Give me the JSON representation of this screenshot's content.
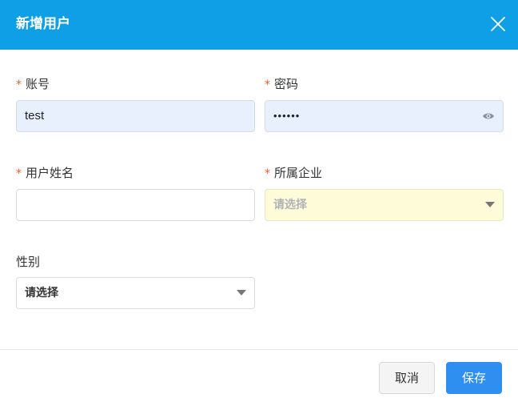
{
  "dialog": {
    "title": "新增用户",
    "close_icon": "close-icon"
  },
  "form": {
    "account": {
      "label": "账号",
      "required_mark": "*",
      "value": "test"
    },
    "password": {
      "label": "密码",
      "required_mark": "*",
      "value": "••••••",
      "toggle_icon": "eye-icon"
    },
    "user_name": {
      "label": "用户姓名",
      "required_mark": "*",
      "value": ""
    },
    "company": {
      "label": "所属企业",
      "required_mark": "*",
      "placeholder": "请选择"
    },
    "gender": {
      "label": "性别",
      "selected": "请选择"
    }
  },
  "footer": {
    "cancel_label": "取消",
    "save_label": "保存"
  },
  "colors": {
    "header": "#0f9fe6",
    "required": "#f05a28",
    "save_button": "#2e8ff0",
    "filled_input": "#e8f0fe",
    "warn_input": "#fefbd8"
  }
}
